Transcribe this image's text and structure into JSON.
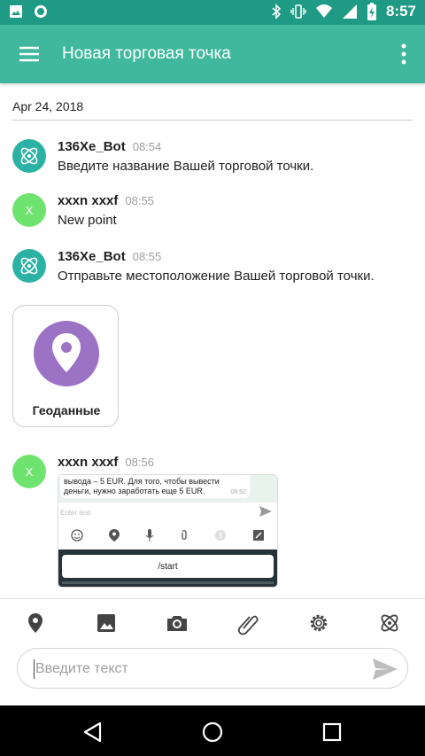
{
  "status_bar": {
    "time": "8:57"
  },
  "app_bar": {
    "title": "Новая торговая точка"
  },
  "date_header": "Apr 24, 2018",
  "messages": [
    {
      "sender": "136Xe_Bot",
      "time": "08:54",
      "text": "Введите название Вашей торговой точки."
    },
    {
      "sender": "xxxn xxxf",
      "avatar_letter": "X",
      "time": "08:55",
      "text": "New point"
    },
    {
      "sender": "136Xe_Bot",
      "time": "08:55",
      "text": "Отправьте местоположение Вашей торговой точки."
    },
    {
      "sender": "xxxn xxxf",
      "avatar_letter": "X",
      "time": "08:56"
    }
  ],
  "geo_card": {
    "label": "Геоданные"
  },
  "screenshot_attachment": {
    "bubble_text": "вывода – 5 EUR. Для того, чтобы вывести деньги, нужно заработать еще 5 EUR.",
    "bubble_time": "08:52",
    "input_placeholder": "Enter text",
    "start_button": "/start"
  },
  "composer": {
    "placeholder": "Введите текст"
  },
  "colors": {
    "status_bar": "#1f9a84",
    "app_bar": "#3fb89e",
    "bot_avatar": "#2bb2a5",
    "user_avatar": "#6fe36f",
    "geo_pin": "#9b72c4"
  },
  "toolbar_icons": [
    "location-icon",
    "image-icon",
    "camera-icon",
    "attachment-icon",
    "settings-icon",
    "atom-icon"
  ]
}
